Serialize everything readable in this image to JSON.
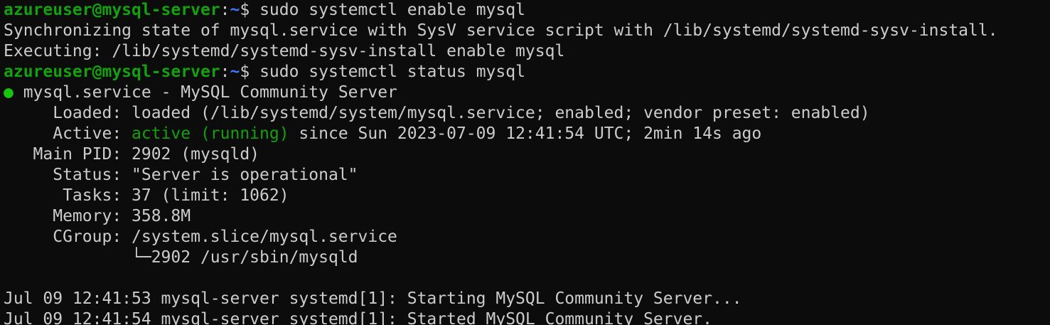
{
  "prompt": {
    "user_host": "azureuser@mysql-server",
    "colon": ":",
    "path": "~",
    "dollar": "$ "
  },
  "lines": {
    "cmd1": "sudo systemctl enable mysql",
    "out1": "Synchronizing state of mysql.service with SysV service script with /lib/systemd/systemd-sysv-install.",
    "out2": "Executing: /lib/systemd/systemd-sysv-install enable mysql",
    "cmd2": "sudo systemctl status mysql",
    "service_dot": "●",
    "service_title": " mysql.service - MySQL Community Server",
    "loaded": "     Loaded: loaded (/lib/systemd/system/mysql.service; enabled; vendor preset: enabled)",
    "active_label": "     Active: ",
    "active_state": "active (running)",
    "active_rest": " since Sun 2023-07-09 12:41:54 UTC; 2min 14s ago",
    "main_pid": "   Main PID: 2902 (mysqld)",
    "status": "     Status: \"Server is operational\"",
    "tasks": "      Tasks: 37 (limit: 1062)",
    "memory": "     Memory: 358.8M",
    "cgroup": "     CGroup: /system.slice/mysql.service",
    "cgroup_child": "             └─2902 /usr/sbin/mysqld",
    "blank": "",
    "log1": "Jul 09 12:41:53 mysql-server systemd[1]: Starting MySQL Community Server...",
    "log2": "Jul 09 12:41:54 mysql-server systemd[1]: Started MySQL Community Server."
  },
  "colors": {
    "background": "#0c0c0c",
    "foreground": "#cccccc",
    "prompt_green": "#13a10e",
    "prompt_blue": "#3b78ff",
    "active_green": "#13a10e"
  }
}
